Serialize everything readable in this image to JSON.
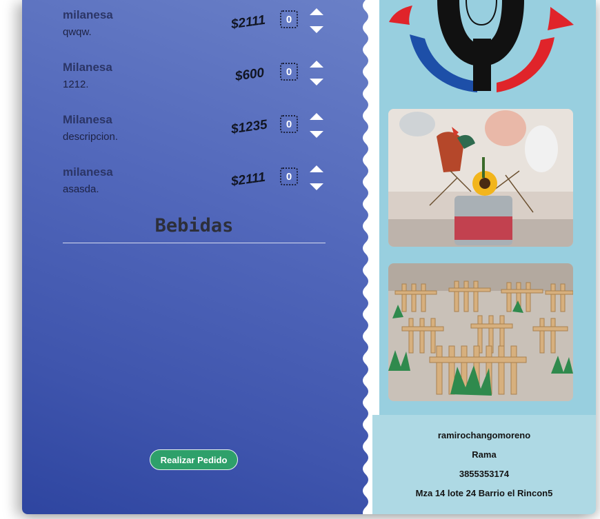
{
  "menu": {
    "items": [
      {
        "name": "milanesa",
        "description": "qwqw.",
        "price": "$2111",
        "quantity": "0"
      },
      {
        "name": "Milanesa",
        "description": "1212.",
        "price": "$600",
        "quantity": "0"
      },
      {
        "name": "Milanesa",
        "description": "descripcion.",
        "price": "$1235",
        "quantity": "0"
      },
      {
        "name": "milanesa",
        "description": "asasda.",
        "price": "$2111",
        "quantity": "0"
      }
    ],
    "section_title": "Bebidas",
    "order_button": "Realizar Pedido"
  },
  "contact": {
    "username": "ramirochangomoreno",
    "name": "Rama",
    "phone": "3855353174",
    "address": "Mza 14 lote 24 Barrio el Rincon5"
  },
  "colors": {
    "menu_panel_top": "#6a80c7",
    "menu_panel_bottom": "#2e45a0",
    "side_panel": "#98cfdf",
    "order_button": "#2ea06a",
    "logo_red": "#e0242a",
    "logo_blue": "#1d4fa8",
    "logo_black": "#111111"
  }
}
